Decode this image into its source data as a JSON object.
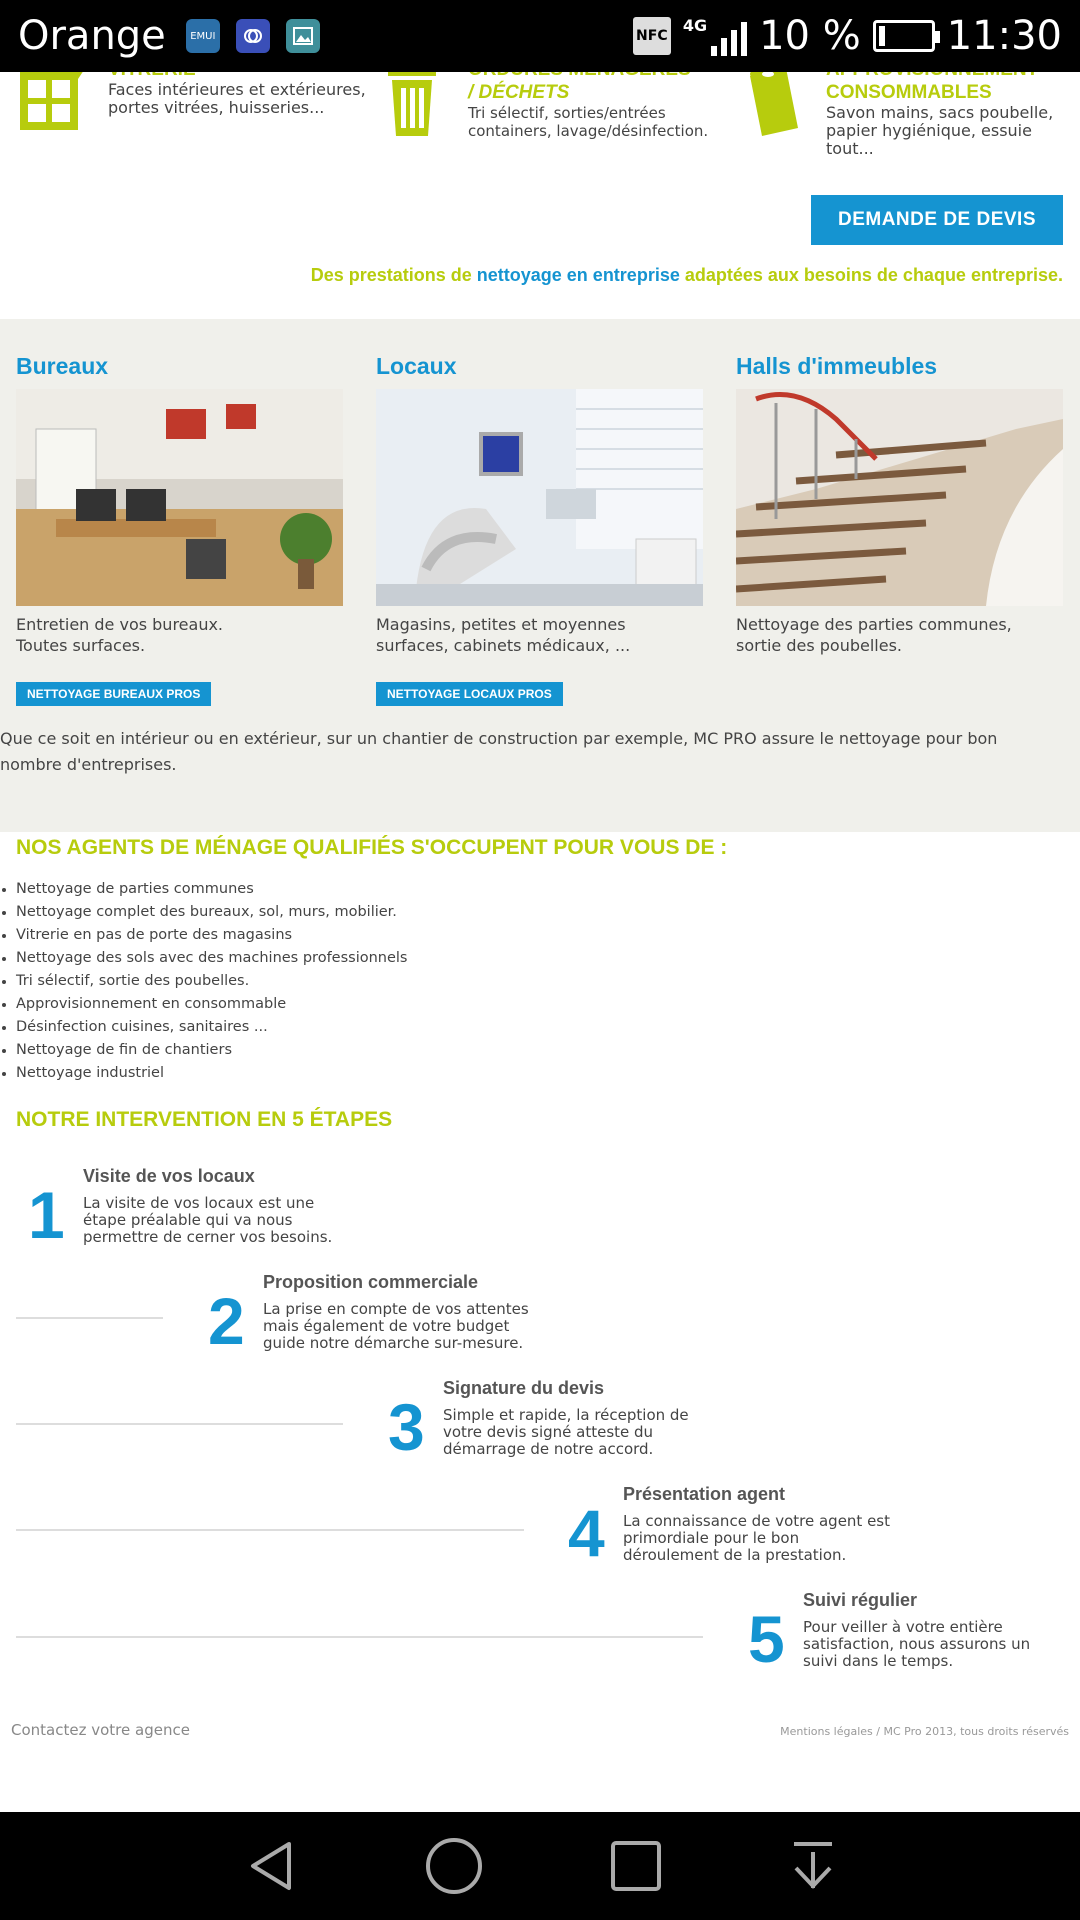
{
  "status_bar": {
    "carrier": "Orange",
    "notif1": "EMUI",
    "nfc": "NFC",
    "network": "4G",
    "battery": "10 %",
    "time": "11:30"
  },
  "services": [
    {
      "title": "VITRERIE",
      "desc1": "Faces intérieures et extérieures,",
      "desc2": "portes vitrées, huisseries..."
    },
    {
      "title1": "ORDURES MÉNAGÈRES",
      "title2": "/ DÉCHETS",
      "desc1": "Tri sélectif, sorties/entrées",
      "desc2": "containers, lavage/désinfection."
    },
    {
      "title1": "APPROVISIONNEMENT",
      "title2": "CONSOMMABLES",
      "desc1": "Savon mains, sacs poubelle,",
      "desc2": "papier hygiénique, essuie tout..."
    }
  ],
  "quote_button": "DEMANDE DE DEVIS",
  "tagline": {
    "part1": "Des prestations de ",
    "link": "nettoyage en entreprise",
    "part2": " adaptées aux besoins de chaque entreprise."
  },
  "columns": [
    {
      "title": "Bureaux",
      "desc1": "Entretien de vos bureaux.",
      "desc2": "Toutes surfaces.",
      "button": "NETTOYAGE BUREAUX PROS"
    },
    {
      "title": "Locaux",
      "desc1": "Magasins, petites et moyennes",
      "desc2": "surfaces, cabinets médicaux, ...",
      "button": "NETTOYAGE LOCAUX PROS"
    },
    {
      "title": "Halls d'immeubles",
      "desc1": "Nettoyage des parties communes,",
      "desc2": "sortie des poubelles."
    }
  ],
  "band_text": "Que ce soit en intérieur ou en extérieur, sur un chantier de construction par exemple, MC PRO assure le nettoyage pour bon nombre d'entreprises.",
  "agents": {
    "title": "NOS AGENTS DE MÉNAGE QUALIFIÉS S'OCCUPENT POUR VOUS DE :",
    "items": [
      "Nettoyage de parties communes",
      "Nettoyage complet des bureaux, sol, murs, mobilier.",
      "Vitrerie en pas de porte des magasins",
      "Nettoyage des sols avec des machines professionnels",
      "Tri sélectif, sortie des poubelles.",
      "Approvisionnement en consommable",
      "Désinfection cuisines, sanitaires ...",
      "Nettoyage de fin de chantiers",
      "Nettoyage industriel"
    ]
  },
  "steps": {
    "title": "NOTRE INTERVENTION EN 5 ÉTAPES",
    "items": [
      {
        "num": "1",
        "title": "Visite de vos locaux",
        "desc": "La visite de vos locaux est une étape préalable qui va nous permettre de cerner vos besoins."
      },
      {
        "num": "2",
        "title": "Proposition commerciale",
        "desc": "La prise en compte de vos attentes mais également de votre budget guide notre démarche sur-mesure."
      },
      {
        "num": "3",
        "title": "Signature du devis",
        "desc": "Simple et rapide, la réception de votre devis signé atteste du démarrage de notre accord."
      },
      {
        "num": "4",
        "title": "Présentation agent",
        "desc": "La connaissance de votre agent est primordiale pour le bon déroulement de la prestation."
      },
      {
        "num": "5",
        "title": "Suivi régulier",
        "desc": "Pour veiller à votre entière satisfaction, nous assurons un suivi dans le temps."
      }
    ]
  },
  "footer": {
    "left": "Contactez votre agence",
    "right": "Mentions légales / MC Pro 2013, tous droits réservés"
  },
  "colors": {
    "accent_blue": "#1594d1",
    "accent_green": "#b7cc0d"
  }
}
